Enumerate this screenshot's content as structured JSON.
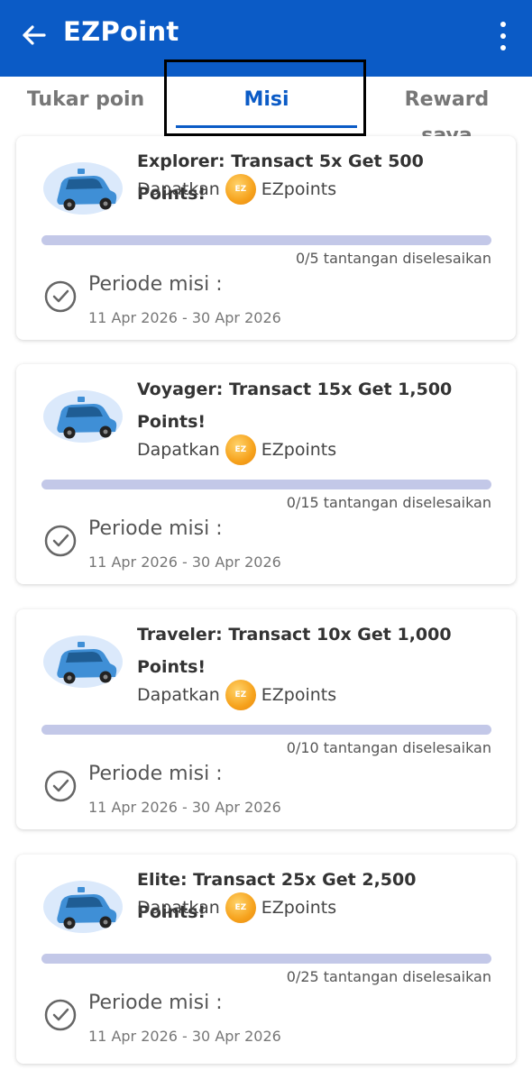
{
  "header": {
    "title": "EZPoint",
    "back_icon": "arrow-left-icon",
    "menu_icon": "more-vertical-icon"
  },
  "tabs": [
    {
      "label": "Tukar poin",
      "active": false
    },
    {
      "label": "Misi",
      "active": true
    },
    {
      "label": "Reward saya",
      "active": false
    }
  ],
  "missions": [
    {
      "title_lines": [
        "Explorer: Transact 5x Get 500 Points!"
      ],
      "reward_prefix": "Dapatkan",
      "reward_suffix": "EZpoints",
      "coin_label": "EZ",
      "progress_done": 0,
      "progress_total": 5,
      "progress_text": "0/5 tantangan diselesaikan",
      "period_label": "Periode misi :",
      "period_dates": "11 Apr 2026 - 30 Apr 2026"
    },
    {
      "title_lines": [
        "Voyager: Transact 15x Get 1,500",
        "Points!"
      ],
      "reward_prefix": "Dapatkan",
      "reward_suffix": "EZpoints",
      "coin_label": "EZ",
      "progress_done": 0,
      "progress_total": 15,
      "progress_text": "0/15 tantangan diselesaikan",
      "period_label": "Periode misi :",
      "period_dates": "11 Apr 2026 - 30 Apr 2026"
    },
    {
      "title_lines": [
        "Traveler: Transact 10x Get 1,000",
        "Points!"
      ],
      "reward_prefix": "Dapatkan",
      "reward_suffix": "EZpoints",
      "coin_label": "EZ",
      "progress_done": 0,
      "progress_total": 10,
      "progress_text": "0/10 tantangan diselesaikan",
      "period_label": "Periode misi :",
      "period_dates": "11 Apr 2026 - 30 Apr 2026"
    },
    {
      "title_lines": [
        "Elite: Transact 25x Get 2,500 Points!"
      ],
      "reward_prefix": "Dapatkan",
      "reward_suffix": "EZpoints",
      "coin_label": "EZ",
      "progress_done": 0,
      "progress_total": 25,
      "progress_text": "0/25 tantangan diselesaikan",
      "period_label": "Periode misi :",
      "period_dates": "11 Apr 2026 - 30 Apr 2026"
    }
  ],
  "colors": {
    "primary": "#0b5bc6",
    "progress_track": "#c3c8e8",
    "coin": "#f6a21c",
    "car": "#3f8fd6"
  }
}
